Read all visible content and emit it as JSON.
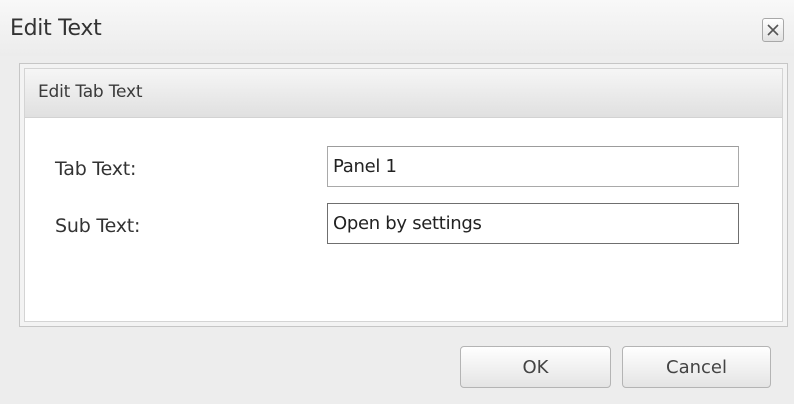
{
  "dialog": {
    "title": "Edit Text",
    "close_icon": "close-icon"
  },
  "panel": {
    "title": "Edit Tab Text"
  },
  "form": {
    "tab_text": {
      "label": "Tab Text:",
      "value": "Panel 1"
    },
    "sub_text": {
      "label": "Sub Text:",
      "value": "Open by settings"
    }
  },
  "buttons": {
    "ok": "OK",
    "cancel": "Cancel"
  }
}
